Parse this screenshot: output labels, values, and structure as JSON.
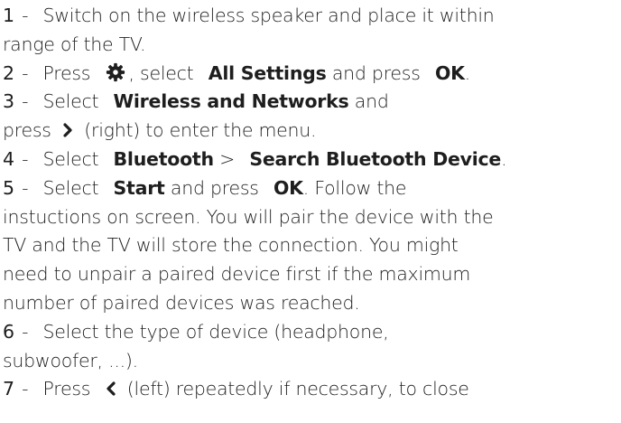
{
  "steps": [
    {
      "number": "1",
      "text_a": "Switch on the wireless speaker and place it within",
      "text_b": "range of the TV."
    },
    {
      "number": "2",
      "text_a": "Press",
      "icon": "gear-icon",
      "text_b": ", select",
      "bold_a": "All Settings",
      "text_c": "and press",
      "bold_b": "OK",
      "text_d": "."
    },
    {
      "number": "3",
      "text_a": "Select",
      "bold_a": "Wireless and Networks",
      "text_b": "and",
      "text_c": "press",
      "icon": "chevron-right-icon",
      "text_d": "(right) to enter the menu."
    },
    {
      "number": "4",
      "text_a": "Select",
      "bold_a": "Bluetooth",
      "text_b": ">",
      "bold_b": "Search Bluetooth Device",
      "text_c": "."
    },
    {
      "number": "5",
      "text_a": "Select",
      "bold_a": "Start",
      "text_b": "and press",
      "bold_b": "OK",
      "text_c": ". Follow the",
      "lines": [
        "instuctions on screen. You will pair the device with the",
        "TV and the TV will store the connection. You might",
        "need to unpair a paired device first if the maximum",
        "number of paired devices was reached."
      ]
    },
    {
      "number": "6",
      "text_a": "Select the type of device (headphone,",
      "text_b": "subwoofer, ...)."
    },
    {
      "number": "7",
      "text_a": "Press",
      "icon": "chevron-left-icon",
      "text_b": "(left) repeatedly if necessary, to close"
    }
  ],
  "separator": "-"
}
